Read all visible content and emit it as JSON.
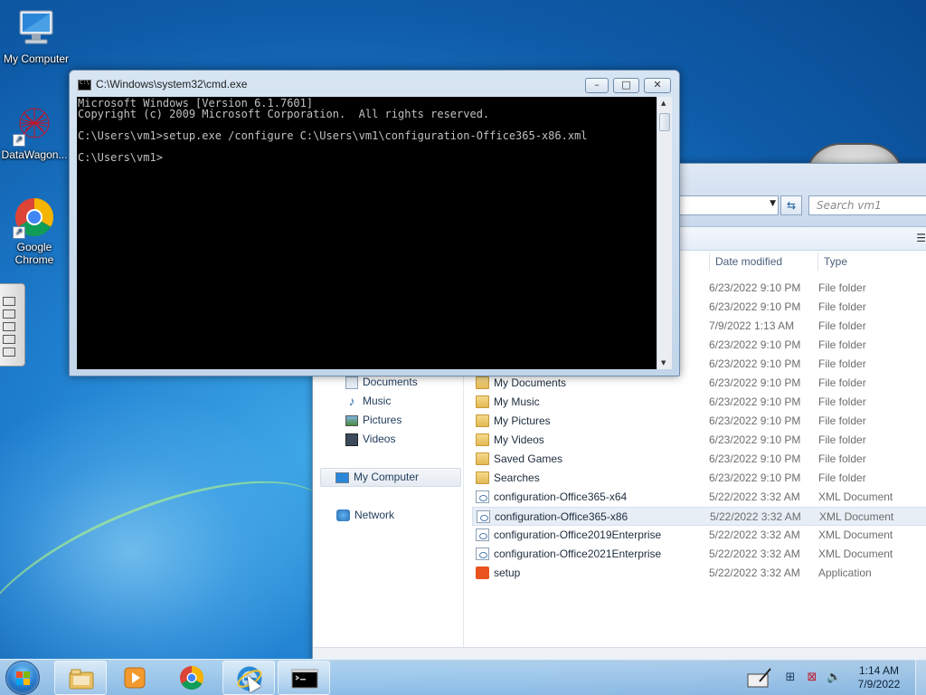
{
  "desktop": {
    "icons": [
      {
        "label": "My Computer",
        "icon": "computer-icon"
      },
      {
        "label": "DataWagon...",
        "icon": "datawagon-icon"
      },
      {
        "label": "Google Chrome",
        "icon": "chrome-icon"
      }
    ]
  },
  "cmd": {
    "title": "C:\\Windows\\system32\\cmd.exe",
    "lines": [
      "Microsoft Windows [Version 6.1.7601]",
      "Copyright (c) 2009 Microsoft Corporation.  All rights reserved.",
      "",
      "C:\\Users\\vm1>setup.exe /configure C:\\Users\\vm1\\configuration-Office365-x86.xml",
      "",
      "C:\\Users\\vm1>"
    ],
    "controls": {
      "minimize": "–",
      "maximize": "□",
      "close": "✕"
    }
  },
  "explorer": {
    "search_placeholder": "Search vm1",
    "columns": {
      "date": "Date modified",
      "type": "Type"
    },
    "nav": [
      {
        "label": "Documents",
        "icon": "documents-icon"
      },
      {
        "label": "Music",
        "icon": "music-icon"
      },
      {
        "label": "Pictures",
        "icon": "pictures-icon"
      },
      {
        "label": "Videos",
        "icon": "videos-icon"
      },
      {
        "label": "My Computer",
        "icon": "computer-icon"
      },
      {
        "label": "Network",
        "icon": "network-icon"
      }
    ],
    "partial_rows": [
      {
        "date": "6/23/2022 9:10 PM",
        "type": "File folder"
      },
      {
        "date": "6/23/2022 9:10 PM",
        "type": "File folder"
      },
      {
        "date": "7/9/2022 1:13 AM",
        "type": "File folder"
      },
      {
        "date": "6/23/2022 9:10 PM",
        "type": "File folder"
      },
      {
        "date": "6/23/2022 9:10 PM",
        "type": "File folder"
      }
    ],
    "files": [
      {
        "name": "My Documents",
        "date": "6/23/2022 9:10 PM",
        "type": "File folder",
        "icon": "folder-icon"
      },
      {
        "name": "My Music",
        "date": "6/23/2022 9:10 PM",
        "type": "File folder",
        "icon": "folder-icon"
      },
      {
        "name": "My Pictures",
        "date": "6/23/2022 9:10 PM",
        "type": "File folder",
        "icon": "folder-icon"
      },
      {
        "name": "My Videos",
        "date": "6/23/2022 9:10 PM",
        "type": "File folder",
        "icon": "folder-icon"
      },
      {
        "name": "Saved Games",
        "date": "6/23/2022 9:10 PM",
        "type": "File folder",
        "icon": "folder-icon"
      },
      {
        "name": "Searches",
        "date": "6/23/2022 9:10 PM",
        "type": "File folder",
        "icon": "folder-icon"
      },
      {
        "name": "configuration-Office365-x64",
        "date": "5/22/2022 3:32 AM",
        "type": "XML Document",
        "icon": "xml-file-icon"
      },
      {
        "name": "configuration-Office365-x86",
        "date": "5/22/2022 3:32 AM",
        "type": "XML Document",
        "icon": "xml-file-icon",
        "selected": true
      },
      {
        "name": "configuration-Office2019Enterprise",
        "date": "5/22/2022 3:32 AM",
        "type": "XML Document",
        "icon": "xml-file-icon"
      },
      {
        "name": "configuration-Office2021Enterprise",
        "date": "5/22/2022 3:32 AM",
        "type": "XML Document",
        "icon": "xml-file-icon"
      },
      {
        "name": "setup",
        "date": "5/22/2022 3:32 AM",
        "type": "Application",
        "icon": "office-app-icon"
      }
    ]
  },
  "taskbar": {
    "items": [
      {
        "name": "file-explorer-taskbar-button",
        "icon": "folder-icon"
      },
      {
        "name": "media-player-taskbar-button",
        "icon": "media-player-icon"
      },
      {
        "name": "chrome-taskbar-button",
        "icon": "chrome-icon"
      },
      {
        "name": "internet-explorer-taskbar-button",
        "icon": "internet-explorer-icon"
      },
      {
        "name": "cmd-taskbar-button",
        "icon": "cmd-icon"
      }
    ],
    "clock_time": "1:14 AM",
    "clock_date": "7/9/2022"
  },
  "colors": {
    "accent": "#1f7fcf",
    "console_bg": "#000000",
    "console_fg": "#c0c0c0"
  }
}
